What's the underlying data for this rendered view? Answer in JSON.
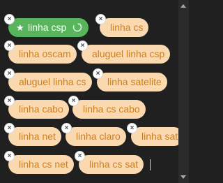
{
  "tags": [
    {
      "label": "linha csp",
      "active": true
    },
    {
      "label": "linha cs",
      "active": false
    },
    {
      "label": "linha oscam",
      "active": false
    },
    {
      "label": "aluguel linha csp",
      "active": false
    },
    {
      "label": "aluguel linha cs",
      "active": false
    },
    {
      "label": "linha satelite",
      "active": false
    },
    {
      "label": "linha cabo",
      "active": false
    },
    {
      "label": "linha cs cabo",
      "active": false
    },
    {
      "label": "linha net",
      "active": false
    },
    {
      "label": "linha claro",
      "active": false
    },
    {
      "label": "linha sat",
      "active": false
    },
    {
      "label": "linha cs net",
      "active": false
    },
    {
      "label": "linha cs sat",
      "active": false
    }
  ],
  "colors": {
    "background": "#1f1f1f",
    "active_tag": "#58b55b",
    "tag_background": "#fbd9b0",
    "tag_text": "#cf7f19"
  },
  "icons": {
    "remove": "close-icon",
    "favorite": "star-icon",
    "refresh": "refresh-icon"
  }
}
